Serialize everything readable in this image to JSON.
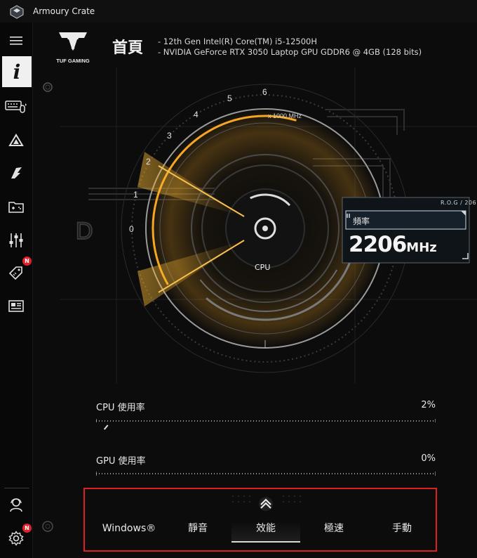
{
  "window": {
    "title": "Armoury Crate"
  },
  "sidebar": {
    "items": [
      {
        "name": "menu",
        "icon": "hamburger-icon"
      },
      {
        "name": "info",
        "icon": "info-icon",
        "label": "i",
        "active": true
      },
      {
        "name": "devices",
        "icon": "keyboard-mouse-icon"
      },
      {
        "name": "aura",
        "icon": "aura-triangle-icon"
      },
      {
        "name": "armoury",
        "icon": "armoury-blade-icon"
      },
      {
        "name": "game-library",
        "icon": "gamepad-folder-icon"
      },
      {
        "name": "settings-sliders",
        "icon": "sliders-icon"
      },
      {
        "name": "deals",
        "icon": "price-tag-icon",
        "badge": "N"
      },
      {
        "name": "news",
        "icon": "news-icon"
      },
      {
        "name": "user",
        "icon": "user-headset-icon"
      },
      {
        "name": "settings",
        "icon": "gear-icon",
        "badge": "N"
      }
    ]
  },
  "header": {
    "brand": "TUF GAMING",
    "title": "首頁",
    "cpu_spec": "-   12th Gen Intel(R) Core(TM) i5-12500H",
    "gpu_spec": "-   NVIDIA GeForce RTX 3050 Laptop GPU GDDR6 @ 4GB (128 bits)"
  },
  "gauge": {
    "ticks": [
      "0",
      "1",
      "2",
      "3",
      "4",
      "5",
      "6"
    ],
    "unit": "x 1000 MHz",
    "center_label": "CPU",
    "side_letter": "D"
  },
  "frequency": {
    "panel_title": "R.O.G / 206",
    "label": "頻率",
    "value": "2206",
    "unit": "MHz",
    "value_mhz": 2206
  },
  "utilization": {
    "cpu": {
      "label": "CPU 使用率",
      "value": "2%",
      "percent": 2
    },
    "gpu": {
      "label": "GPU 使用率",
      "value": "0%",
      "percent": 0
    }
  },
  "modes": {
    "items": [
      "Windows®",
      "靜音",
      "效能",
      "極速",
      "手動"
    ],
    "selected": "效能"
  },
  "colors": {
    "accent": "#f5a623",
    "alert": "#e0202a",
    "highlight_border": "#e02020"
  }
}
